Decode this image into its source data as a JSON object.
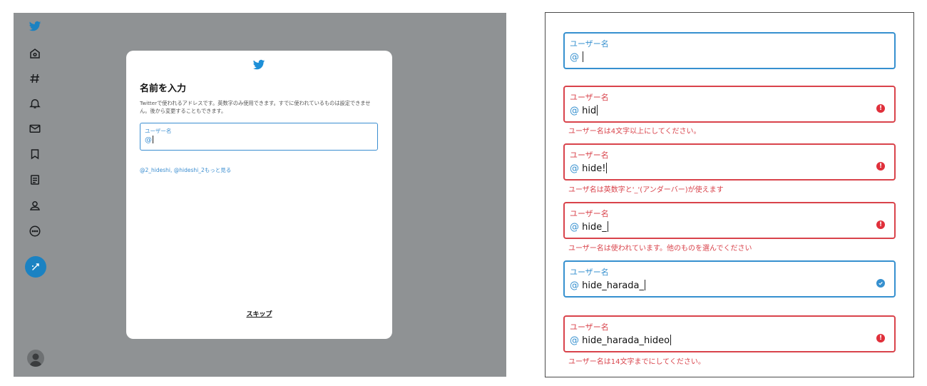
{
  "sidebar": {
    "icons": [
      "twitter-logo-icon",
      "home-icon",
      "hashtag-icon",
      "bell-icon",
      "mail-icon",
      "bookmark-icon",
      "list-icon",
      "profile-icon",
      "more-icon"
    ]
  },
  "modal": {
    "title": "名前を入力",
    "description": "Twitterで使われるアドレスです。英数字のみ使用できます。すでに使われているものは設定できません。後から変更することもできます。",
    "field_label": "ユーザー名",
    "field_prefix": "@",
    "suggestions": "@2_hideshi, @hideshi_2もっと見る",
    "skip_label": "スキップ"
  },
  "examples": [
    {
      "label": "ユーザー名",
      "prefix": "@",
      "value": "",
      "state": "focus",
      "error": ""
    },
    {
      "label": "ユーザー名",
      "prefix": "@",
      "value": "hid",
      "state": "error",
      "error": "ユーザー名は4文字以上にしてください。"
    },
    {
      "label": "ユーザー名",
      "prefix": "@",
      "value": "hide!",
      "state": "error",
      "error": "ユーザ名は英数字と'_'(アンダーバー)が使えます"
    },
    {
      "label": "ユーザー名",
      "prefix": "@",
      "value": "hide_",
      "state": "error",
      "error": "ユーザー名は使われています。他のものを選んでください"
    },
    {
      "label": "ユーザー名",
      "prefix": "@",
      "value": "hide_harada_",
      "state": "valid",
      "error": ""
    },
    {
      "label": "ユーザー名",
      "prefix": "@",
      "value": "hide_harada_hideo",
      "state": "error",
      "error": "ユーザー名は14文字までにしてください。"
    }
  ],
  "colors": {
    "accent": "#3690cf",
    "error": "#d9434b",
    "overlay": "#8f9294"
  }
}
